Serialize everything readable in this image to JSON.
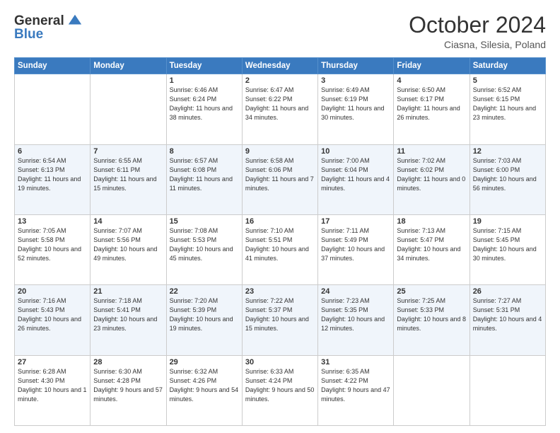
{
  "header": {
    "logo_general": "General",
    "logo_blue": "Blue",
    "month_title": "October 2024",
    "subtitle": "Ciasna, Silesia, Poland"
  },
  "weekdays": [
    "Sunday",
    "Monday",
    "Tuesday",
    "Wednesday",
    "Thursday",
    "Friday",
    "Saturday"
  ],
  "weeks": [
    [
      {
        "day": "",
        "sunrise": "",
        "sunset": "",
        "daylight": ""
      },
      {
        "day": "",
        "sunrise": "",
        "sunset": "",
        "daylight": ""
      },
      {
        "day": "1",
        "sunrise": "Sunrise: 6:46 AM",
        "sunset": "Sunset: 6:24 PM",
        "daylight": "Daylight: 11 hours and 38 minutes."
      },
      {
        "day": "2",
        "sunrise": "Sunrise: 6:47 AM",
        "sunset": "Sunset: 6:22 PM",
        "daylight": "Daylight: 11 hours and 34 minutes."
      },
      {
        "day": "3",
        "sunrise": "Sunrise: 6:49 AM",
        "sunset": "Sunset: 6:19 PM",
        "daylight": "Daylight: 11 hours and 30 minutes."
      },
      {
        "day": "4",
        "sunrise": "Sunrise: 6:50 AM",
        "sunset": "Sunset: 6:17 PM",
        "daylight": "Daylight: 11 hours and 26 minutes."
      },
      {
        "day": "5",
        "sunrise": "Sunrise: 6:52 AM",
        "sunset": "Sunset: 6:15 PM",
        "daylight": "Daylight: 11 hours and 23 minutes."
      }
    ],
    [
      {
        "day": "6",
        "sunrise": "Sunrise: 6:54 AM",
        "sunset": "Sunset: 6:13 PM",
        "daylight": "Daylight: 11 hours and 19 minutes."
      },
      {
        "day": "7",
        "sunrise": "Sunrise: 6:55 AM",
        "sunset": "Sunset: 6:11 PM",
        "daylight": "Daylight: 11 hours and 15 minutes."
      },
      {
        "day": "8",
        "sunrise": "Sunrise: 6:57 AM",
        "sunset": "Sunset: 6:08 PM",
        "daylight": "Daylight: 11 hours and 11 minutes."
      },
      {
        "day": "9",
        "sunrise": "Sunrise: 6:58 AM",
        "sunset": "Sunset: 6:06 PM",
        "daylight": "Daylight: 11 hours and 7 minutes."
      },
      {
        "day": "10",
        "sunrise": "Sunrise: 7:00 AM",
        "sunset": "Sunset: 6:04 PM",
        "daylight": "Daylight: 11 hours and 4 minutes."
      },
      {
        "day": "11",
        "sunrise": "Sunrise: 7:02 AM",
        "sunset": "Sunset: 6:02 PM",
        "daylight": "Daylight: 11 hours and 0 minutes."
      },
      {
        "day": "12",
        "sunrise": "Sunrise: 7:03 AM",
        "sunset": "Sunset: 6:00 PM",
        "daylight": "Daylight: 10 hours and 56 minutes."
      }
    ],
    [
      {
        "day": "13",
        "sunrise": "Sunrise: 7:05 AM",
        "sunset": "Sunset: 5:58 PM",
        "daylight": "Daylight: 10 hours and 52 minutes."
      },
      {
        "day": "14",
        "sunrise": "Sunrise: 7:07 AM",
        "sunset": "Sunset: 5:56 PM",
        "daylight": "Daylight: 10 hours and 49 minutes."
      },
      {
        "day": "15",
        "sunrise": "Sunrise: 7:08 AM",
        "sunset": "Sunset: 5:53 PM",
        "daylight": "Daylight: 10 hours and 45 minutes."
      },
      {
        "day": "16",
        "sunrise": "Sunrise: 7:10 AM",
        "sunset": "Sunset: 5:51 PM",
        "daylight": "Daylight: 10 hours and 41 minutes."
      },
      {
        "day": "17",
        "sunrise": "Sunrise: 7:11 AM",
        "sunset": "Sunset: 5:49 PM",
        "daylight": "Daylight: 10 hours and 37 minutes."
      },
      {
        "day": "18",
        "sunrise": "Sunrise: 7:13 AM",
        "sunset": "Sunset: 5:47 PM",
        "daylight": "Daylight: 10 hours and 34 minutes."
      },
      {
        "day": "19",
        "sunrise": "Sunrise: 7:15 AM",
        "sunset": "Sunset: 5:45 PM",
        "daylight": "Daylight: 10 hours and 30 minutes."
      }
    ],
    [
      {
        "day": "20",
        "sunrise": "Sunrise: 7:16 AM",
        "sunset": "Sunset: 5:43 PM",
        "daylight": "Daylight: 10 hours and 26 minutes."
      },
      {
        "day": "21",
        "sunrise": "Sunrise: 7:18 AM",
        "sunset": "Sunset: 5:41 PM",
        "daylight": "Daylight: 10 hours and 23 minutes."
      },
      {
        "day": "22",
        "sunrise": "Sunrise: 7:20 AM",
        "sunset": "Sunset: 5:39 PM",
        "daylight": "Daylight: 10 hours and 19 minutes."
      },
      {
        "day": "23",
        "sunrise": "Sunrise: 7:22 AM",
        "sunset": "Sunset: 5:37 PM",
        "daylight": "Daylight: 10 hours and 15 minutes."
      },
      {
        "day": "24",
        "sunrise": "Sunrise: 7:23 AM",
        "sunset": "Sunset: 5:35 PM",
        "daylight": "Daylight: 10 hours and 12 minutes."
      },
      {
        "day": "25",
        "sunrise": "Sunrise: 7:25 AM",
        "sunset": "Sunset: 5:33 PM",
        "daylight": "Daylight: 10 hours and 8 minutes."
      },
      {
        "day": "26",
        "sunrise": "Sunrise: 7:27 AM",
        "sunset": "Sunset: 5:31 PM",
        "daylight": "Daylight: 10 hours and 4 minutes."
      }
    ],
    [
      {
        "day": "27",
        "sunrise": "Sunrise: 6:28 AM",
        "sunset": "Sunset: 4:30 PM",
        "daylight": "Daylight: 10 hours and 1 minute."
      },
      {
        "day": "28",
        "sunrise": "Sunrise: 6:30 AM",
        "sunset": "Sunset: 4:28 PM",
        "daylight": "Daylight: 9 hours and 57 minutes."
      },
      {
        "day": "29",
        "sunrise": "Sunrise: 6:32 AM",
        "sunset": "Sunset: 4:26 PM",
        "daylight": "Daylight: 9 hours and 54 minutes."
      },
      {
        "day": "30",
        "sunrise": "Sunrise: 6:33 AM",
        "sunset": "Sunset: 4:24 PM",
        "daylight": "Daylight: 9 hours and 50 minutes."
      },
      {
        "day": "31",
        "sunrise": "Sunrise: 6:35 AM",
        "sunset": "Sunset: 4:22 PM",
        "daylight": "Daylight: 9 hours and 47 minutes."
      },
      {
        "day": "",
        "sunrise": "",
        "sunset": "",
        "daylight": ""
      },
      {
        "day": "",
        "sunrise": "",
        "sunset": "",
        "daylight": ""
      }
    ]
  ]
}
